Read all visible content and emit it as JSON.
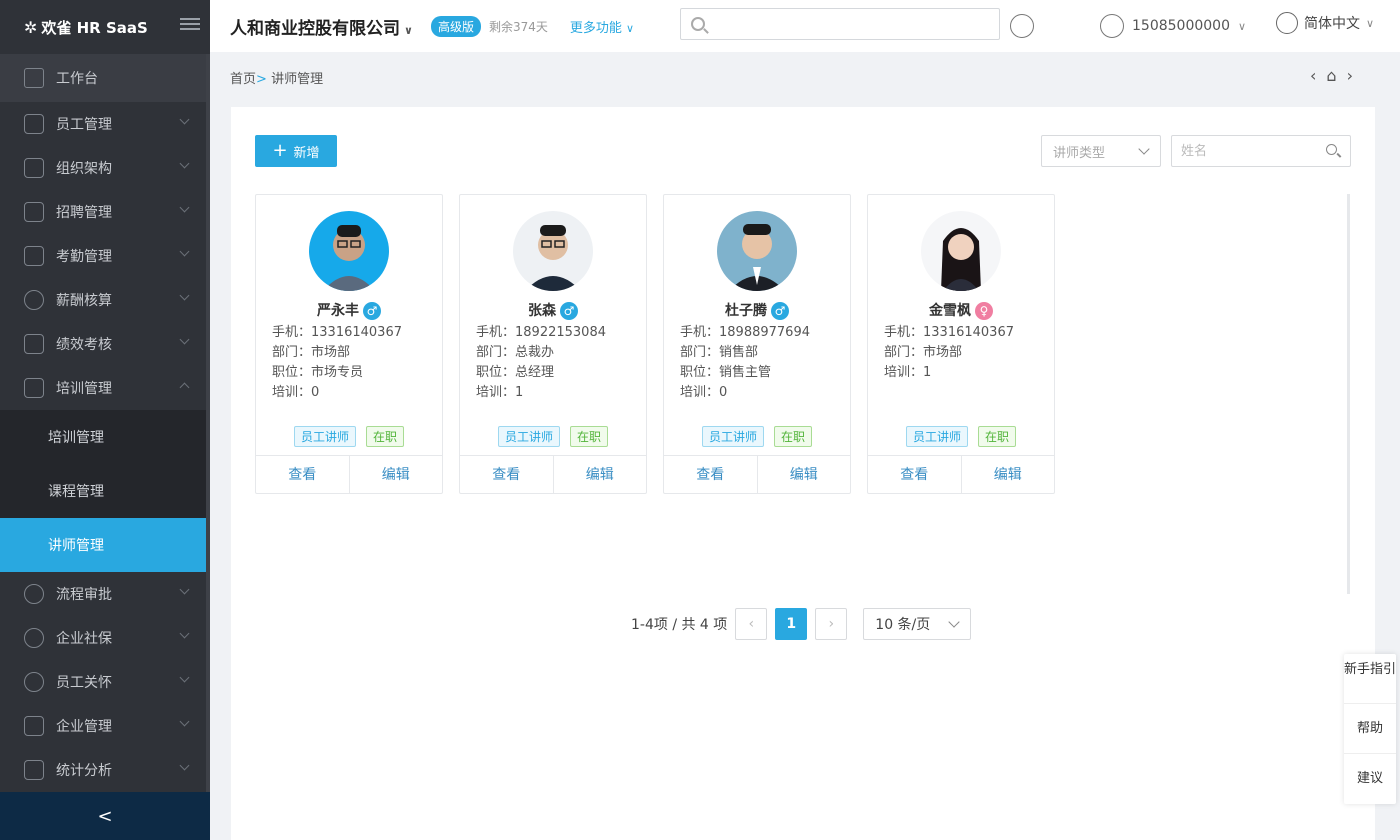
{
  "brand": {
    "logo_text": "欢雀 HR SaaS"
  },
  "sidebar": {
    "workbench": "工作台",
    "items": [
      {
        "label": "员工管理",
        "icon": "people-icon"
      },
      {
        "label": "组织架构",
        "icon": "org-icon"
      },
      {
        "label": "招聘管理",
        "icon": "recruit-icon"
      },
      {
        "label": "考勤管理",
        "icon": "attendance-icon"
      },
      {
        "label": "薪酬核算",
        "icon": "yen-icon"
      },
      {
        "label": "绩效考核",
        "icon": "chart-icon"
      },
      {
        "label": "培训管理",
        "icon": "clipboard-icon"
      }
    ],
    "sub_items": [
      "培训管理",
      "课程管理",
      "讲师管理"
    ],
    "items_after": [
      {
        "label": "流程审批",
        "icon": "flow-icon"
      },
      {
        "label": "企业社保",
        "icon": "shield-user-icon"
      },
      {
        "label": "员工关怀",
        "icon": "care-icon"
      },
      {
        "label": "企业管理",
        "icon": "lock-icon"
      },
      {
        "label": "统计分析",
        "icon": "analytics-icon"
      }
    ],
    "collapse_glyph": "<"
  },
  "topbar": {
    "company": "人和商业控股有限公司",
    "edition": "高级版",
    "remaining": "剩余374天",
    "more": "更多功能",
    "phone": "15085000000",
    "language": "简体中文"
  },
  "breadcrumb": {
    "home": "首页",
    "sep": ">",
    "current": "讲师管理"
  },
  "toolbar": {
    "add_label": "新增",
    "type_placeholder": "讲师类型",
    "name_placeholder": "姓名"
  },
  "cards": [
    {
      "name": "严永丰",
      "gender": "♂",
      "phone": "手机：13316140367",
      "dept": "部门：市场部",
      "position": "职位：市场专员",
      "training": "培训：0",
      "tag_type": "员工讲师",
      "tag_status": "在职",
      "view": "查看",
      "edit": "编辑"
    },
    {
      "name": "张森",
      "gender": "♂",
      "phone": "手机：18922153084",
      "dept": "部门：总裁办",
      "position": "职位：总经理",
      "training": "培训：1",
      "tag_type": "员工讲师",
      "tag_status": "在职",
      "view": "查看",
      "edit": "编辑"
    },
    {
      "name": "杜子腾",
      "gender": "♂",
      "phone": "手机：18988977694",
      "dept": "部门：销售部",
      "position": "职位：销售主管",
      "training": "培训：0",
      "tag_type": "员工讲师",
      "tag_status": "在职",
      "view": "查看",
      "edit": "编辑"
    },
    {
      "name": "金雪枫",
      "gender": "♀",
      "phone": "手机：13316140367",
      "dept": "部门：市场部",
      "position": "培训：1",
      "training": "",
      "tag_type": "员工讲师",
      "tag_status": "在职",
      "view": "查看",
      "edit": "编辑"
    }
  ],
  "pagination": {
    "summary": "1-4项 / 共 4 项",
    "current": "1",
    "page_size": "10 条/页"
  },
  "helper": {
    "guide": "新手指引",
    "help": "帮助",
    "suggest": "建议"
  },
  "colors": {
    "accent": "#29a8e0",
    "sidebar_bg": "#2f3238",
    "sidebar_bottom": "#0d2a45"
  }
}
